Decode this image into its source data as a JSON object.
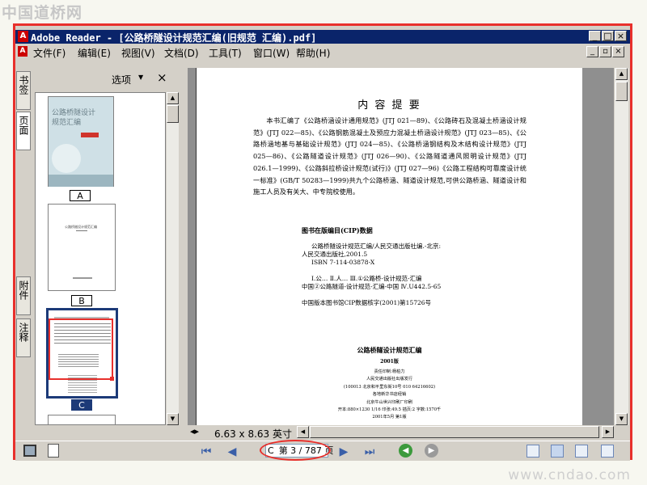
{
  "watermark_top": "中国道桥网",
  "watermark_bottom": "www.cndao.com",
  "window": {
    "title": "Adobe Reader - [公路桥隧设计规范汇编(旧规范 汇编).pdf]",
    "app_icon": "A"
  },
  "menu": [
    "文件(F)",
    "编辑(E)",
    "视图(V)",
    "文档(D)",
    "工具(T)",
    "窗口(W)",
    "帮助(H)"
  ],
  "side_tabs": {
    "bookmarks": "书签",
    "pages": "页面",
    "attachments": "附件",
    "comments": "注释"
  },
  "panel": {
    "options_label": "选项",
    "close": "×",
    "thumbnails": [
      {
        "label": "A",
        "cover_title": "公路桥隧设计规范汇编"
      },
      {
        "label": "B",
        "caption": "公路桥隧设计规范汇编"
      },
      {
        "label": "C"
      }
    ]
  },
  "document": {
    "heading": "内 容 提 要",
    "summary": "本书汇编了《公路桥涵设计通用规范》(JTJ 021—89)、《公路砖石及混凝土桥涵设计规范》(JTJ 022—85)、《公路钢筋混凝土及预应力混凝土桥涵设计规范》(JTJ 023—85)、《公路桥涵地基与基础设计规范》(JTJ 024—85)、《公路桥涵钢结构及木结构设计规范》(JTJ 025—86)、《公路隧道设计规范》(JTJ 026—90)、《公路隧道通风照明设计规范》(JTJ 026.1—1999)、《公路斜拉桥设计规范(试行)》(JTJ 027—96)《公路工程结构可靠度设计统一标准》(GB/T 50283—1999)共九个公路桥涵、隧道设计规范,可供公路桥涵、隧道设计和施工人员及有关大、中专院校使用。",
    "cip_heading": "图书在版编目(CIP)数据",
    "cip_lines": [
      "公路桥隧设计规范汇编/人民交通出版社编.-北京:",
      "人民交通出版社,2001.5",
      "ISBN 7-114-03878-X",
      "",
      "Ⅰ.公… Ⅱ.人… Ⅲ.①公路桥-设计规范-汇编",
      "中国②公路隧道-设计规范-汇编-中国 Ⅳ.U442.5-65",
      "",
      "中国版本图书馆CIP数据核字(2001)第15726号"
    ],
    "colophon_title": "公路桥隧设计规范汇编",
    "colophon_edition": "2001版",
    "colophon_lines": [
      "责任印制:杨柏力",
      "人民交通出版社出版发行",
      "(100013 北京和平里东街10号 010 64216602)",
      "各地新华书店经销",
      "北京牛山世兴印刷厂印刷",
      "开本:880×1230 1/16 印张:49.5 插页:2 字数:1570千",
      "2001年5月 第1版"
    ]
  },
  "page_size": "6.63 x 8.63 英寸",
  "navigation": {
    "current_page": "C",
    "page_counter": "第 3 / 787 页"
  }
}
